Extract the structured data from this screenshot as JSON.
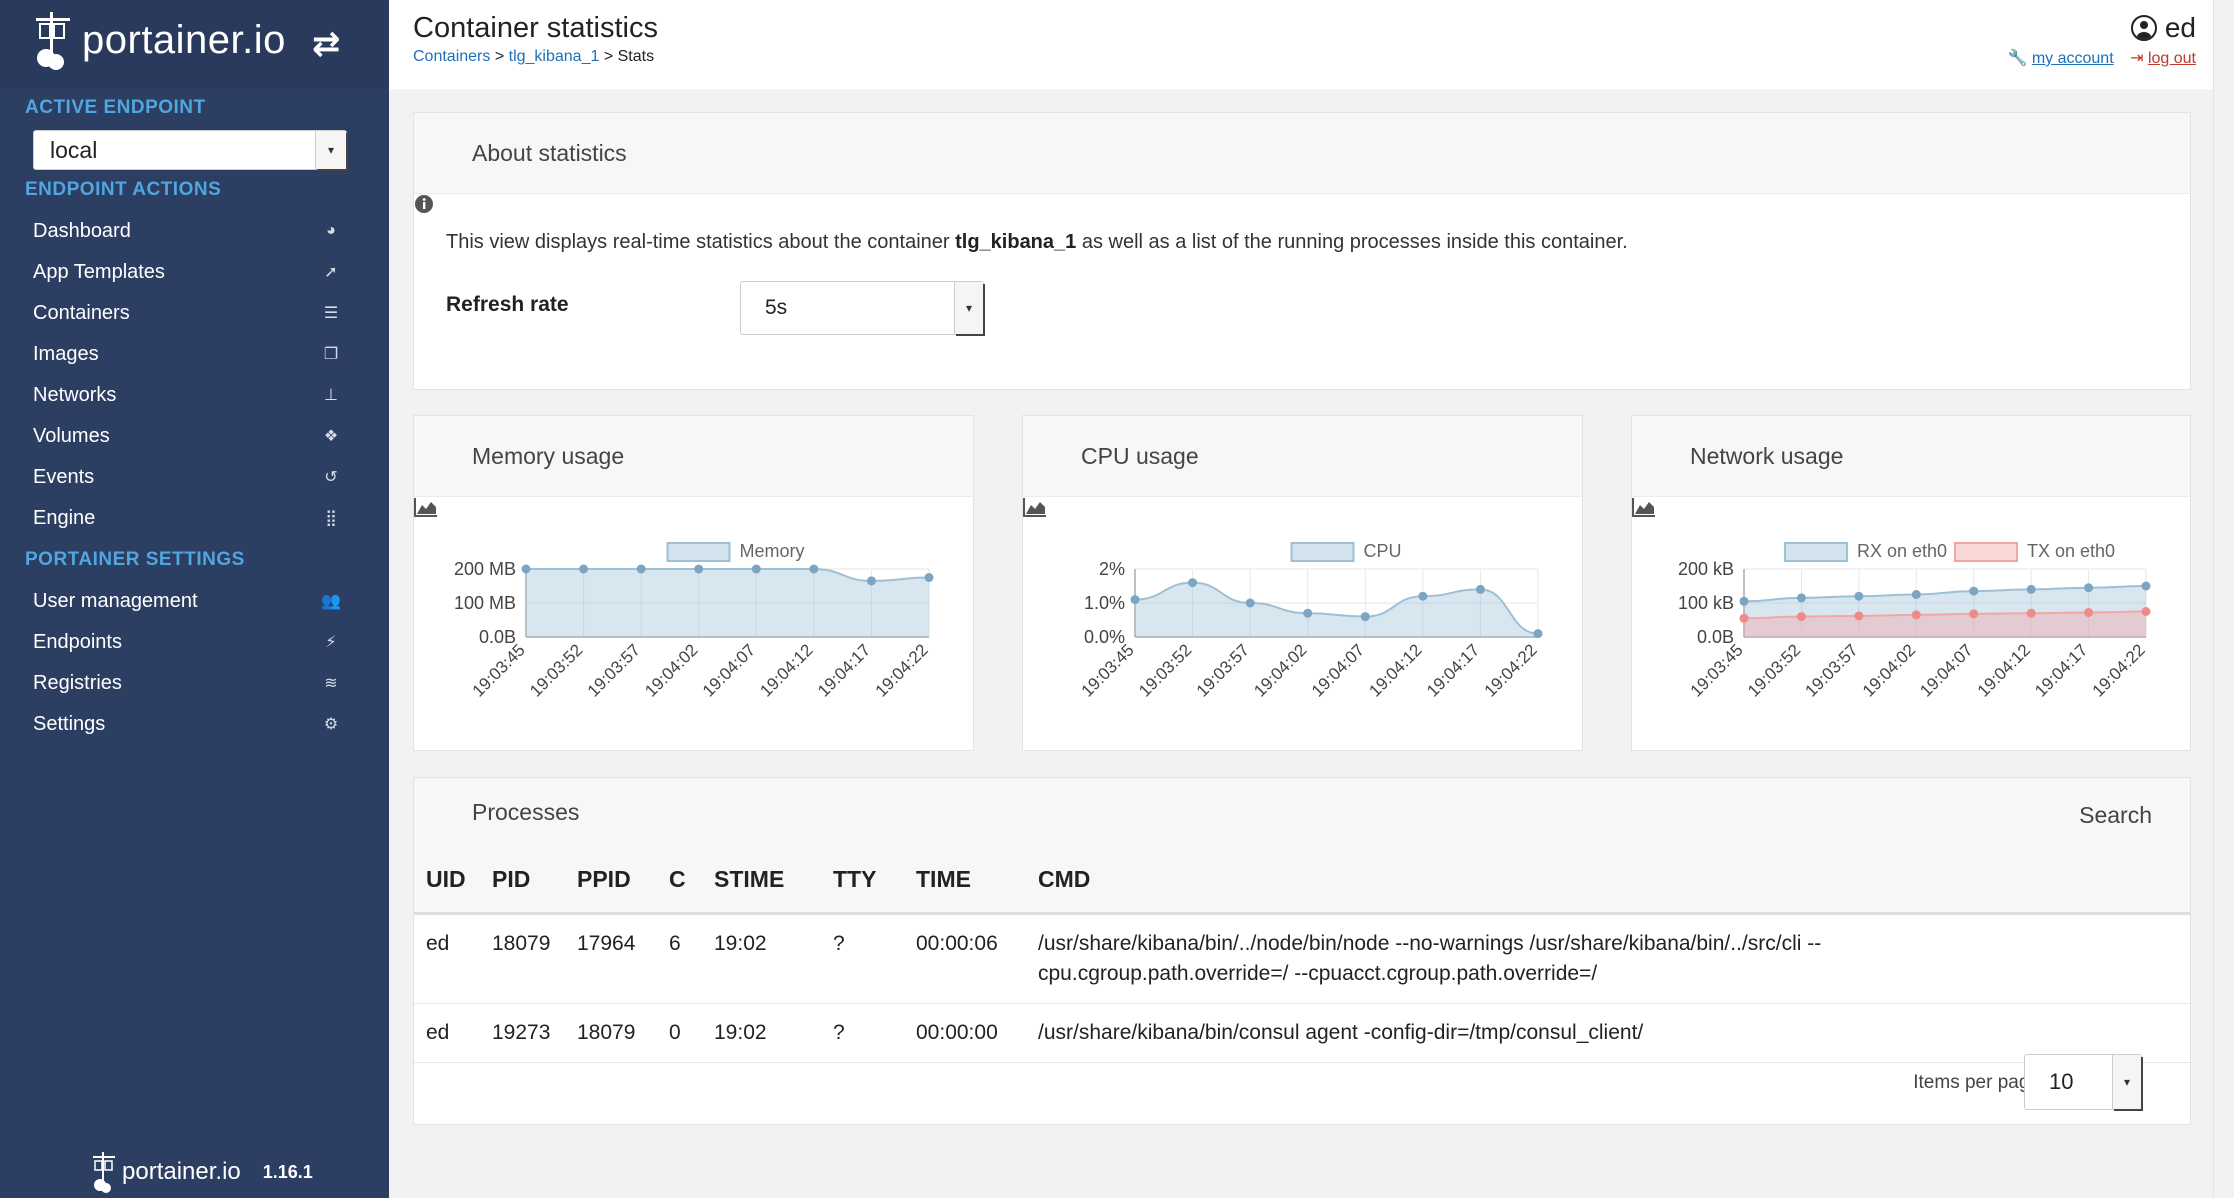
{
  "sidebar": {
    "logo_text": "portainer.io",
    "swap_icon": "arrows-swap-icon",
    "active_endpoint_label": "ACTIVE ENDPOINT",
    "endpoint_value": "local",
    "endpoint_actions_label": "ENDPOINT ACTIONS",
    "items": [
      {
        "label": "Dashboard",
        "icon": "tachometer-icon"
      },
      {
        "label": "App Templates",
        "icon": "rocket-icon"
      },
      {
        "label": "Containers",
        "icon": "server-icon"
      },
      {
        "label": "Images",
        "icon": "clone-icon"
      },
      {
        "label": "Networks",
        "icon": "sitemap-icon"
      },
      {
        "label": "Volumes",
        "icon": "cubes-icon"
      },
      {
        "label": "Events",
        "icon": "history-icon"
      },
      {
        "label": "Engine",
        "icon": "grid-icon"
      }
    ],
    "settings_label": "PORTAINER SETTINGS",
    "settings_items": [
      {
        "label": "User management",
        "icon": "users-icon"
      },
      {
        "label": "Endpoints",
        "icon": "plug-icon"
      },
      {
        "label": "Registries",
        "icon": "database-icon"
      },
      {
        "label": "Settings",
        "icon": "cogs-icon"
      }
    ],
    "footer_text": "portainer.io",
    "version": "1.16.1"
  },
  "header": {
    "title": "Container statistics",
    "breadcrumb": [
      "Containers",
      "tlg_kibana_1",
      "Stats"
    ],
    "user": "ed",
    "my_account": "my account",
    "log_out": "log out"
  },
  "about": {
    "title": "About statistics",
    "desc_pre": "This view displays real-time statistics about the container ",
    "container": "tlg_kibana_1",
    "desc_post": " as well as a list of the running processes inside this container.",
    "refresh_label": "Refresh rate",
    "refresh_value": "5s"
  },
  "panels": {
    "memory_title": "Memory usage",
    "cpu_title": "CPU usage",
    "network_title": "Network usage"
  },
  "chart_data": [
    {
      "type": "area",
      "title": "Memory usage",
      "x": [
        "19:03:45",
        "19:03:52",
        "19:03:57",
        "19:04:02",
        "19:04:07",
        "19:04:12",
        "19:04:17",
        "19:04:22"
      ],
      "series": [
        {
          "name": "Memory",
          "values": [
            200,
            200,
            200,
            200,
            200,
            200,
            165,
            175
          ],
          "color": "#9ec0d7"
        }
      ],
      "y_ticks": [
        "0.0B",
        "100 MB",
        "200 MB"
      ],
      "ylim": [
        0,
        200
      ],
      "legend": "top"
    },
    {
      "type": "area",
      "title": "CPU usage",
      "x": [
        "19:03:45",
        "19:03:52",
        "19:03:57",
        "19:04:02",
        "19:04:07",
        "19:04:12",
        "19:04:17",
        "19:04:22"
      ],
      "series": [
        {
          "name": "CPU",
          "values": [
            1.1,
            1.6,
            1.0,
            0.7,
            0.6,
            1.2,
            1.4,
            0.1
          ],
          "color": "#9ec0d7"
        }
      ],
      "y_ticks": [
        "0.0%",
        "1.0%",
        "2%"
      ],
      "ylim": [
        0,
        2
      ],
      "legend": "top"
    },
    {
      "type": "area",
      "title": "Network usage",
      "x": [
        "19:03:45",
        "19:03:52",
        "19:03:57",
        "19:04:02",
        "19:04:07",
        "19:04:12",
        "19:04:17",
        "19:04:22"
      ],
      "series": [
        {
          "name": "RX on eth0",
          "values": [
            105,
            115,
            120,
            125,
            135,
            140,
            145,
            150
          ],
          "color": "#9ec0d7"
        },
        {
          "name": "TX on eth0",
          "values": [
            55,
            60,
            62,
            65,
            68,
            70,
            72,
            75
          ],
          "color": "#f4a6a6"
        }
      ],
      "y_ticks": [
        "0.0B",
        "100 kB",
        "200 kB"
      ],
      "ylim": [
        0,
        200
      ],
      "legend": "top"
    }
  ],
  "processes": {
    "title": "Processes",
    "search_label": "Search",
    "columns": [
      "UID",
      "PID",
      "PPID",
      "C",
      "STIME",
      "TTY",
      "TIME",
      "CMD"
    ],
    "rows": [
      [
        "ed",
        "18079",
        "17964",
        "6",
        "19:02",
        "?",
        "00:00:06",
        "/usr/share/kibana/bin/../node/bin/node --no-warnings /usr/share/kibana/bin/../src/cli --cpu.cgroup.path.override=/ --cpuacct.cgroup.path.override=/"
      ],
      [
        "ed",
        "19273",
        "18079",
        "0",
        "19:02",
        "?",
        "00:00:00",
        "/usr/share/kibana/bin/consul agent -config-dir=/tmp/consul_client/"
      ]
    ],
    "items_per_page_label": "Items per page",
    "items_per_page": "10"
  }
}
